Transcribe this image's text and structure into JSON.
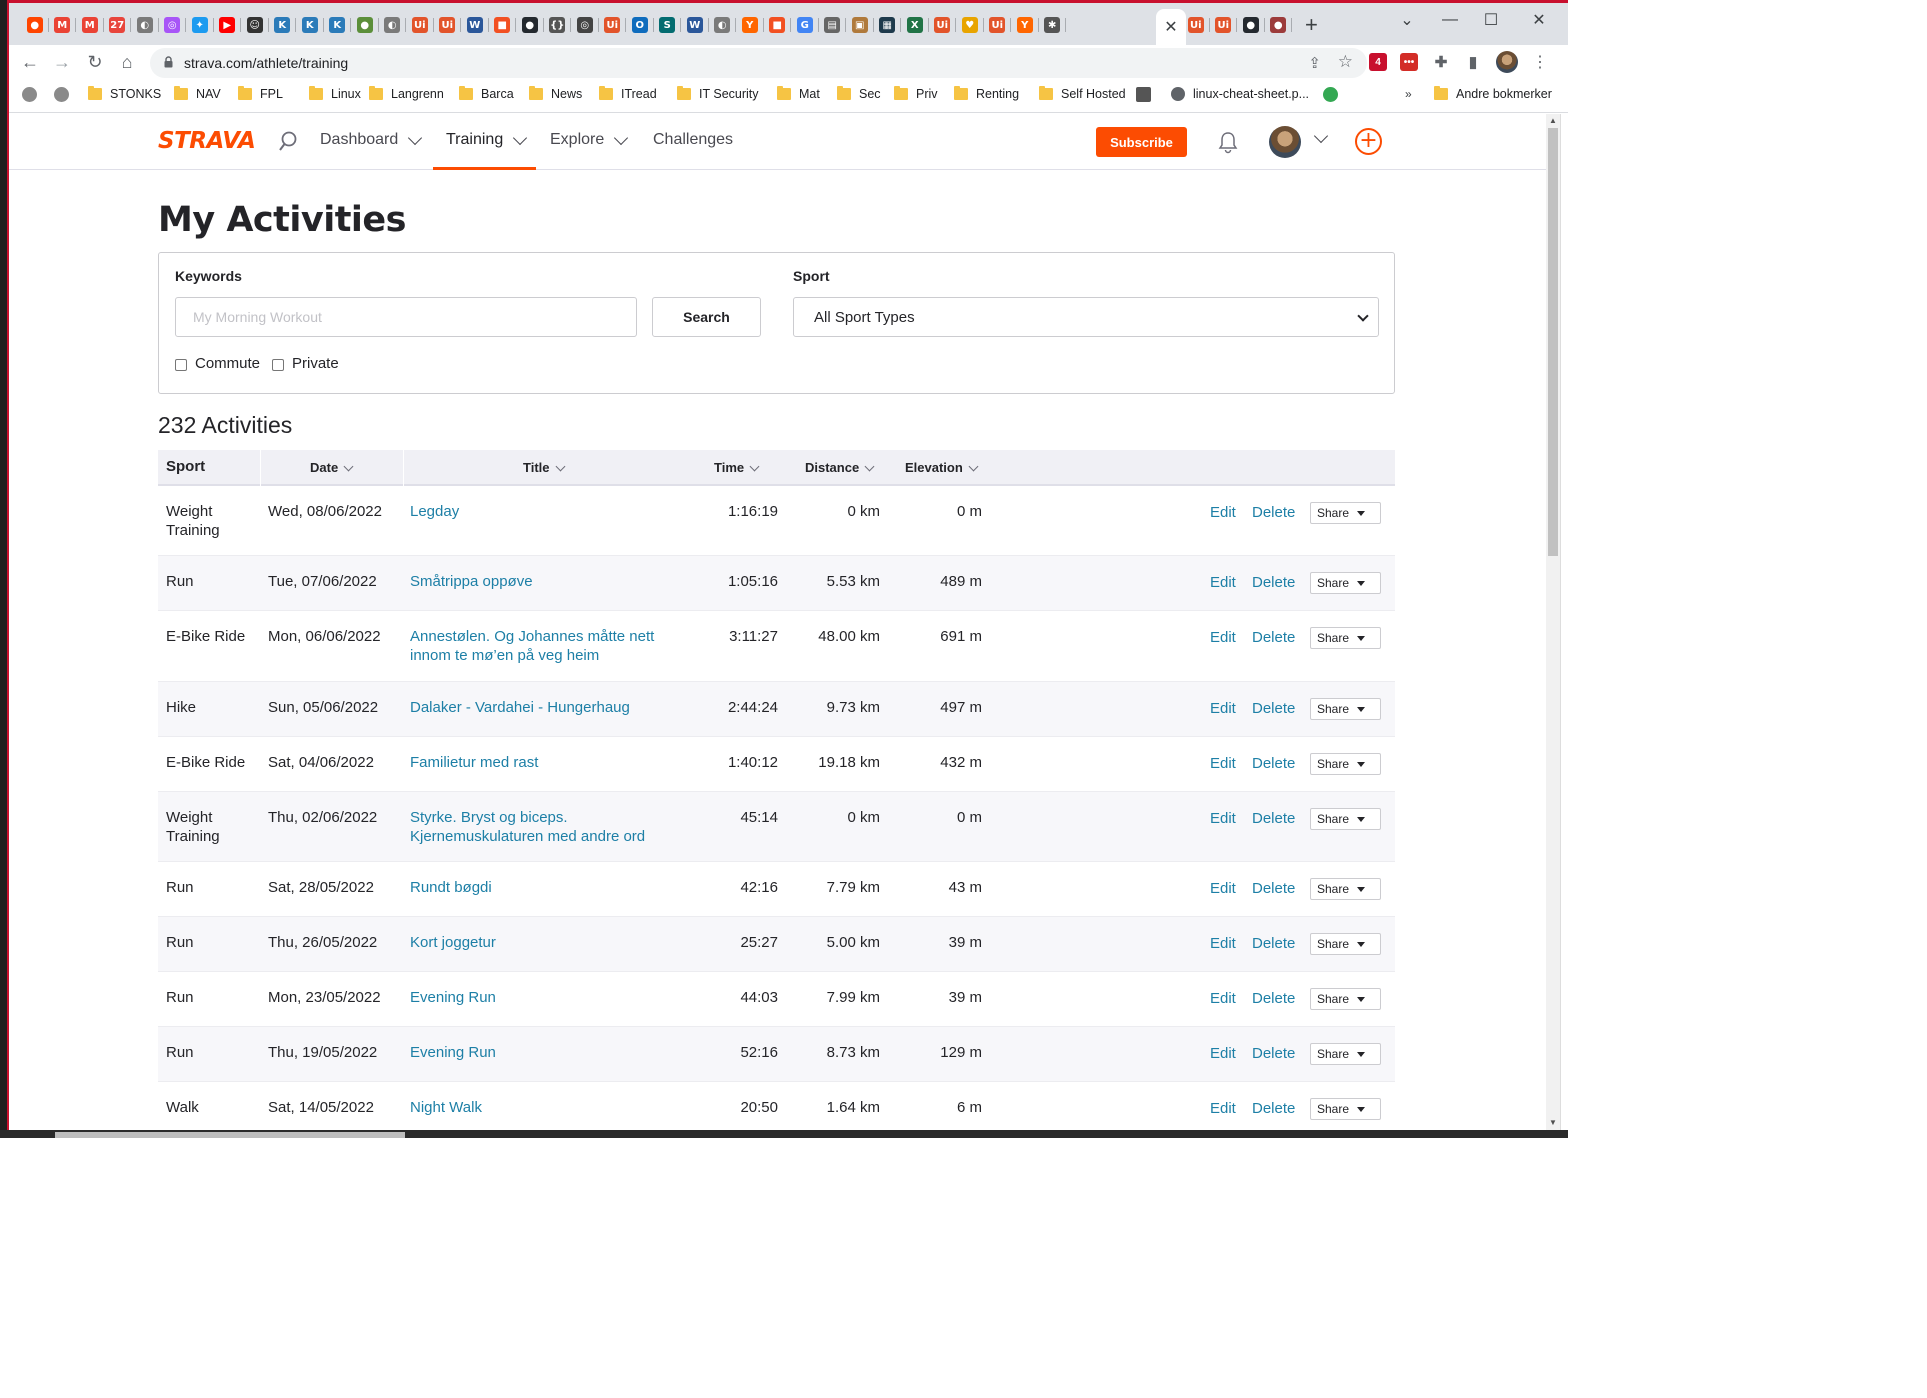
{
  "browser": {
    "tabs_favicons": [
      {
        "icon": "reddit-icon",
        "color": "#ff4500",
        "char": "●"
      },
      {
        "icon": "gmail-icon",
        "color": "#ea4335",
        "char": "M"
      },
      {
        "icon": "gmail-icon",
        "color": "#ea4335",
        "char": "M"
      },
      {
        "icon": "calendar-icon",
        "color": "#e8453c",
        "char": "27"
      },
      {
        "icon": "globe-icon",
        "color": "#7a7a7a",
        "char": "◐"
      },
      {
        "icon": "messenger-icon",
        "color": "#a855f7",
        "char": "◎"
      },
      {
        "icon": "twitter-icon",
        "color": "#1d9bf0",
        "char": "✦"
      },
      {
        "icon": "youtube-icon",
        "color": "#ff0000",
        "char": "▶"
      },
      {
        "icon": "robot-icon",
        "color": "#333333",
        "char": "☺"
      },
      {
        "icon": "k-icon",
        "color": "#2b7bb9",
        "char": "K"
      },
      {
        "icon": "k-icon",
        "color": "#2b7bb9",
        "char": "K"
      },
      {
        "icon": "k-icon",
        "color": "#2b7bb9",
        "char": "K"
      },
      {
        "icon": "leaf-icon",
        "color": "#5c8f3a",
        "char": "●"
      },
      {
        "icon": "globe-icon",
        "color": "#7a7a7a",
        "char": "◐"
      },
      {
        "icon": "ui-icon",
        "color": "#e2542b",
        "char": "Ui"
      },
      {
        "icon": "ui-icon",
        "color": "#e2542b",
        "char": "Ui"
      },
      {
        "icon": "word-icon",
        "color": "#2b579a",
        "char": "W"
      },
      {
        "icon": "microsoft-icon",
        "color": "#f25022",
        "char": "■"
      },
      {
        "icon": "github-icon",
        "color": "#24292f",
        "char": "●"
      },
      {
        "icon": "braces-icon",
        "color": "#555555",
        "char": "{}"
      },
      {
        "icon": "target-icon",
        "color": "#444444",
        "char": "◎"
      },
      {
        "icon": "ui-icon",
        "color": "#e2542b",
        "char": "Ui"
      },
      {
        "icon": "outlook-icon",
        "color": "#0f6cbd",
        "char": "O"
      },
      {
        "icon": "sharepoint-icon",
        "color": "#036c70",
        "char": "S"
      },
      {
        "icon": "word-icon",
        "color": "#2b579a",
        "char": "W"
      },
      {
        "icon": "globe-icon",
        "color": "#7a7a7a",
        "char": "◐"
      },
      {
        "icon": "ycombinator-icon",
        "color": "#ff6600",
        "char": "Y"
      },
      {
        "icon": "microsoft-icon",
        "color": "#f25022",
        "char": "■"
      },
      {
        "icon": "google-icon",
        "color": "#4285f4",
        "char": "G"
      },
      {
        "icon": "document-icon",
        "color": "#666666",
        "char": "▤"
      },
      {
        "icon": "box-icon",
        "color": "#b07a3c",
        "char": "▣"
      },
      {
        "icon": "terminal-icon",
        "color": "#1e3a4c",
        "char": "▦"
      },
      {
        "icon": "excel-icon",
        "color": "#217346",
        "char": "X"
      },
      {
        "icon": "ui-icon",
        "color": "#e2542b",
        "char": "Ui"
      },
      {
        "icon": "bulb-icon",
        "color": "#e8a400",
        "char": "♥"
      },
      {
        "icon": "ui-icon",
        "color": "#e2542b",
        "char": "Ui"
      },
      {
        "icon": "ycombinator-icon",
        "color": "#ff6600",
        "char": "Y"
      },
      {
        "icon": "gear-icon",
        "color": "#555555",
        "char": "✱"
      }
    ],
    "tabs_after_active": [
      {
        "icon": "ui-icon",
        "color": "#e2542b",
        "char": "Ui"
      },
      {
        "icon": "ui-icon",
        "color": "#e2542b",
        "char": "Ui"
      },
      {
        "icon": "github-icon",
        "color": "#24292f",
        "char": "●"
      },
      {
        "icon": "owl-icon",
        "color": "#9c3b3b",
        "char": "●"
      }
    ],
    "active_tab_close": "✕",
    "new_tab": "+",
    "window_controls": {
      "minimize": "—",
      "maximize": "☐",
      "close": "✕",
      "tab_list": "⌄"
    },
    "url": "strava.com/athlete/training",
    "nav": {
      "back": "←",
      "forward": "→",
      "reload": "↻",
      "home": "⌂"
    },
    "omnibox_icons": {
      "share": "⇪",
      "star": "☆"
    },
    "extensions": [
      {
        "icon": "shield-extension-icon",
        "color": "#c8102e",
        "char": "4"
      },
      {
        "icon": "lastpass-icon",
        "color": "#d32d27",
        "char": "•••"
      },
      {
        "icon": "puzzle-icon",
        "color": "#5f6368",
        "char": "✚"
      },
      {
        "icon": "sidepanel-icon",
        "color": "#5f6368",
        "char": "▮"
      }
    ],
    "menu": "⋮",
    "bookmarks": [
      {
        "type": "icon",
        "icon": "globe-icon"
      },
      {
        "type": "icon",
        "icon": "apple-icon"
      },
      {
        "type": "folder",
        "label": "STONKS"
      },
      {
        "type": "folder",
        "label": "NAV"
      },
      {
        "type": "folder",
        "label": "FPL"
      },
      {
        "type": "folder",
        "label": "Linux"
      },
      {
        "type": "folder",
        "label": "Langrenn"
      },
      {
        "type": "folder",
        "label": "Barca"
      },
      {
        "type": "folder",
        "label": "News"
      },
      {
        "type": "folder",
        "label": "ITread"
      },
      {
        "type": "folder",
        "label": "IT Security"
      },
      {
        "type": "folder",
        "label": "Mat"
      },
      {
        "type": "folder",
        "label": "Sec"
      },
      {
        "type": "folder",
        "label": "Priv"
      },
      {
        "type": "folder",
        "label": "Renting"
      },
      {
        "type": "folder",
        "label": "Self Hosted"
      },
      {
        "type": "icon",
        "icon": "calendar-icon"
      },
      {
        "type": "link",
        "label": "linux-cheat-sheet.p..."
      },
      {
        "type": "icon",
        "icon": "smiley-icon"
      }
    ],
    "bookmarks_overflow": "»",
    "other_bookmarks": "Andre bokmerker"
  },
  "strava": {
    "logo": "STRAVA",
    "nav": [
      {
        "label": "Dashboard",
        "dropdown": true
      },
      {
        "label": "Training",
        "dropdown": true,
        "active": true
      },
      {
        "label": "Explore",
        "dropdown": true
      },
      {
        "label": "Challenges",
        "dropdown": false
      }
    ],
    "subscribe": "Subscribe",
    "brand_color": "#fc4c02",
    "link_color": "#1d7fa6"
  },
  "page": {
    "title": "My Activities",
    "filters": {
      "keywords_label": "Keywords",
      "keywords_placeholder": "My Morning Workout",
      "keywords_value": "",
      "search_button": "Search",
      "sport_label": "Sport",
      "sport_selected": "All Sport Types",
      "commute_label": "Commute",
      "private_label": "Private"
    },
    "count_text": "232 Activities",
    "columns": [
      "Sport",
      "Date",
      "Title",
      "Time",
      "Distance",
      "Elevation"
    ],
    "actions": {
      "edit": "Edit",
      "delete": "Delete",
      "share": "Share"
    },
    "activities": [
      {
        "sport": "Weight Training",
        "date": "Wed, 08/06/2022",
        "title": "Legday",
        "time": "1:16:19",
        "distance": "0 km",
        "elevation": "0 m"
      },
      {
        "sport": "Run",
        "date": "Tue, 07/06/2022",
        "title": "Småtrippa oppøve",
        "time": "1:05:16",
        "distance": "5.53 km",
        "elevation": "489 m"
      },
      {
        "sport": "E-Bike Ride",
        "date": "Mon, 06/06/2022",
        "title": "Annestølen. Og Johannes måtte nett innom te mø’en på veg heim",
        "time": "3:11:27",
        "distance": "48.00 km",
        "elevation": "691 m"
      },
      {
        "sport": "Hike",
        "date": "Sun, 05/06/2022",
        "title": "Dalaker - Vardahei - Hungerhaug",
        "time": "2:44:24",
        "distance": "9.73 km",
        "elevation": "497 m"
      },
      {
        "sport": "E-Bike Ride",
        "date": "Sat, 04/06/2022",
        "title": "Familietur med rast",
        "time": "1:40:12",
        "distance": "19.18 km",
        "elevation": "432 m"
      },
      {
        "sport": "Weight Training",
        "date": "Thu, 02/06/2022",
        "title": "Styrke. Bryst og biceps. Kjernemuskulaturen med andre ord",
        "time": "45:14",
        "distance": "0 km",
        "elevation": "0 m"
      },
      {
        "sport": "Run",
        "date": "Sat, 28/05/2022",
        "title": "Rundt bøgdi",
        "time": "42:16",
        "distance": "7.79 km",
        "elevation": "43 m"
      },
      {
        "sport": "Run",
        "date": "Thu, 26/05/2022",
        "title": "Kort joggetur",
        "time": "25:27",
        "distance": "5.00 km",
        "elevation": "39 m"
      },
      {
        "sport": "Run",
        "date": "Mon, 23/05/2022",
        "title": "Evening Run",
        "time": "44:03",
        "distance": "7.99 km",
        "elevation": "39 m"
      },
      {
        "sport": "Run",
        "date": "Thu, 19/05/2022",
        "title": "Evening Run",
        "time": "52:16",
        "distance": "8.73 km",
        "elevation": "129 m"
      },
      {
        "sport": "Walk",
        "date": "Sat, 14/05/2022",
        "title": "Night Walk",
        "time": "20:50",
        "distance": "1.64 km",
        "elevation": "6 m"
      }
    ]
  }
}
